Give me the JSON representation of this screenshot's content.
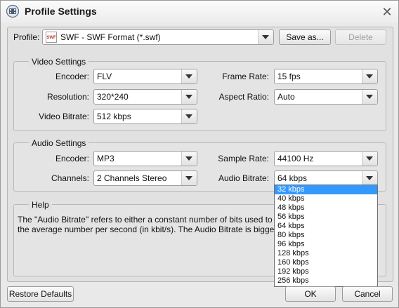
{
  "window": {
    "title": "Profile Settings"
  },
  "profile": {
    "label": "Profile:",
    "value": "SWF - SWF Format (*.swf)",
    "icon_text": "SWF",
    "save_as_label": "Save as...",
    "delete_label": "Delete"
  },
  "video": {
    "title": "Video Settings",
    "encoder": {
      "label": "Encoder:",
      "value": "FLV"
    },
    "resolution": {
      "label": "Resolution:",
      "value": "320*240"
    },
    "bitrate": {
      "label": "Video Bitrate:",
      "value": "512 kbps"
    },
    "frame_rate": {
      "label": "Frame Rate:",
      "value": "15 fps"
    },
    "aspect_ratio": {
      "label": "Aspect Ratio:",
      "value": "Auto"
    }
  },
  "audio": {
    "title": "Audio Settings",
    "encoder": {
      "label": "Encoder:",
      "value": "MP3"
    },
    "channels": {
      "label": "Channels:",
      "value": "2 Channels Stereo"
    },
    "sample_rate": {
      "label": "Sample Rate:",
      "value": "44100 Hz"
    },
    "bitrate": {
      "label": "Audio Bitrate:",
      "value": "64 kbps"
    }
  },
  "help": {
    "title": "Help",
    "line1": "The \"Audio Bitrate\" refers to either a constant number of bits used to Enco",
    "line2": "the average number per second (in kbit/s). The Audio Bitrate is bigger, the"
  },
  "bitrate_options": [
    "32 kbps",
    "40 kbps",
    "48 kbps",
    "56 kbps",
    "64 kbps",
    "80 kbps",
    "96 kbps",
    "128 kbps",
    "160 kbps",
    "192 kbps",
    "256 kbps"
  ],
  "bitrate_highlighted": "32 kbps",
  "footer": {
    "restore_label": "Restore Defaults",
    "ok_label": "OK",
    "cancel_label": "Cancel"
  },
  "colors": {
    "highlight": "#3399ff"
  }
}
